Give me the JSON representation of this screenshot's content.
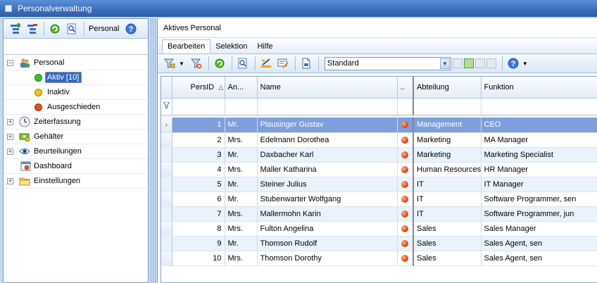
{
  "window": {
    "title": "Personalverwaltung"
  },
  "left_toolbar": {
    "label": "Personal"
  },
  "tree": {
    "items": [
      {
        "label": "Personal"
      },
      {
        "label": "Aktiv [10]",
        "status_color": "#3cbf2e"
      },
      {
        "label": "Inaktiv",
        "status_color": "#f2c21c"
      },
      {
        "label": "Ausgeschieden",
        "status_color": "#e8501a"
      },
      {
        "label": "Zeiterfassung"
      },
      {
        "label": "Gehälter"
      },
      {
        "label": "Beurteilungen"
      },
      {
        "label": "Dashboard"
      },
      {
        "label": "Einstellungen"
      }
    ]
  },
  "right": {
    "title": "Aktives Personal",
    "menu": [
      "Bearbeiten",
      "Selektion",
      "Hilfe"
    ],
    "layout_select": {
      "value": "Standard"
    }
  },
  "grid": {
    "headers": [
      "PersID",
      "An...",
      "Name",
      "..",
      "Abteilung",
      "Funktion"
    ],
    "rows": [
      {
        "id": "1",
        "title": "Mr.",
        "name": "Plausinger Gustav",
        "dept": "Management",
        "func": "CEO"
      },
      {
        "id": "2",
        "title": "Mrs.",
        "name": "Edelmann Dorothea",
        "dept": "Marketing",
        "func": "MA Manager"
      },
      {
        "id": "3",
        "title": "Mr.",
        "name": "Daxbacher Karl",
        "dept": "Marketing",
        "func": "Marketing Specialist"
      },
      {
        "id": "4",
        "title": "Mrs.",
        "name": "Maller Katharina",
        "dept": "Human Resources",
        "func": "HR Manager"
      },
      {
        "id": "5",
        "title": "Mr.",
        "name": "Steiner Julius",
        "dept": "IT",
        "func": "IT Manager"
      },
      {
        "id": "6",
        "title": "Mr.",
        "name": "Stubenwarter Wolfgang",
        "dept": "IT",
        "func": "Software Programmer, sen"
      },
      {
        "id": "7",
        "title": "Mrs.",
        "name": "Mallermohn Karin",
        "dept": "IT",
        "func": "Software Programmer, jun"
      },
      {
        "id": "8",
        "title": "Mrs.",
        "name": "Fulton Angelina",
        "dept": "Sales",
        "func": "Sales Manager"
      },
      {
        "id": "9",
        "title": "Mr.",
        "name": "Thomson Rudolf",
        "dept": "Sales",
        "func": "Sales Agent, sen"
      },
      {
        "id": "10",
        "title": "Mrs.",
        "name": "Thomson Dorothy",
        "dept": "Sales",
        "func": "Sales Agent, sen"
      }
    ]
  }
}
